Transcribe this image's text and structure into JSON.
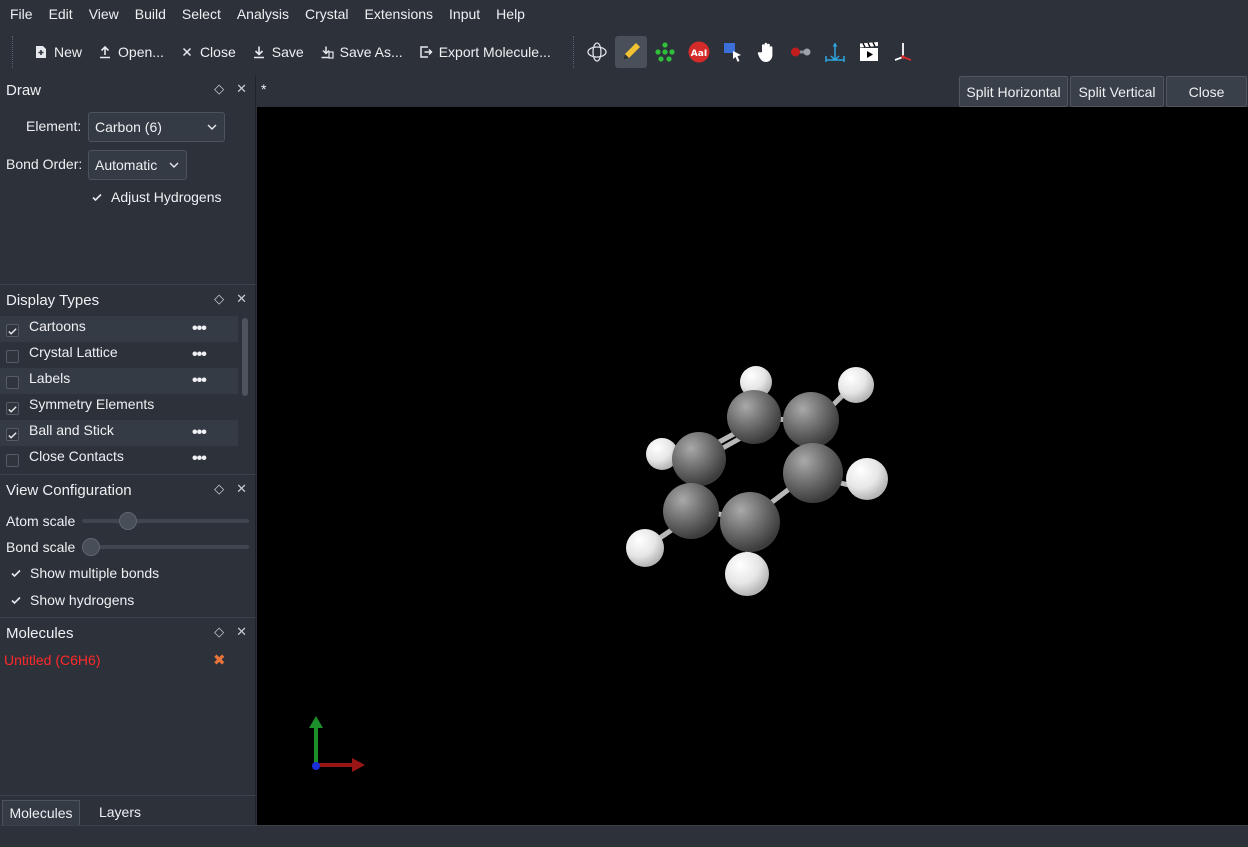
{
  "menu": [
    "File",
    "Edit",
    "View",
    "Build",
    "Select",
    "Analysis",
    "Crystal",
    "Extensions",
    "Input",
    "Help"
  ],
  "toolbar": {
    "new": "New",
    "open": "Open...",
    "close": "Close",
    "save": "Save",
    "save_as": "Save As...",
    "export": "Export Molecule...",
    "tools": [
      "navigate-icon",
      "draw-icon",
      "manipulate-atoms-icon",
      "label-icon",
      "select-icon",
      "hand-icon",
      "measure-icon",
      "align-icon",
      "animation-icon",
      "axes-icon"
    ]
  },
  "draw_panel": {
    "title": "Draw",
    "element_label": "Element:",
    "element_value": "Carbon (6)",
    "bond_order_label": "Bond Order:",
    "bond_order_value": "Automatic",
    "adjust_hydrogens": "Adjust Hydrogens",
    "adjust_hydrogens_checked": true
  },
  "display_types": {
    "title": "Display Types",
    "items": [
      {
        "label": "Cartoons",
        "checked": true,
        "has_settings": true
      },
      {
        "label": "Crystal Lattice",
        "checked": false,
        "has_settings": true
      },
      {
        "label": "Labels",
        "checked": false,
        "has_settings": true
      },
      {
        "label": "Symmetry Elements",
        "checked": true,
        "has_settings": false
      },
      {
        "label": "Ball and Stick",
        "checked": true,
        "has_settings": true
      },
      {
        "label": "Close Contacts",
        "checked": false,
        "has_settings": true
      }
    ],
    "more_symbol": "•••"
  },
  "view_config": {
    "title": "View Configuration",
    "atom_scale_label": "Atom scale",
    "bond_scale_label": "Bond scale",
    "atom_scale_value": 0.25,
    "bond_scale_value": 0.0,
    "show_multiple_bonds": "Show multiple bonds",
    "show_hydrogens": "Show hydrogens"
  },
  "molecules_panel": {
    "title": "Molecules",
    "entry": "Untitled (C6H6)",
    "remove_symbol": "✖"
  },
  "bottom_tabs": [
    "Molecules",
    "Layers"
  ],
  "viewport": {
    "tab_marker": "*",
    "split_horizontal": "Split Horizontal",
    "split_vertical": "Split Vertical",
    "close": "Close"
  },
  "panel_controls": {
    "float": "◇",
    "close": "✕"
  }
}
